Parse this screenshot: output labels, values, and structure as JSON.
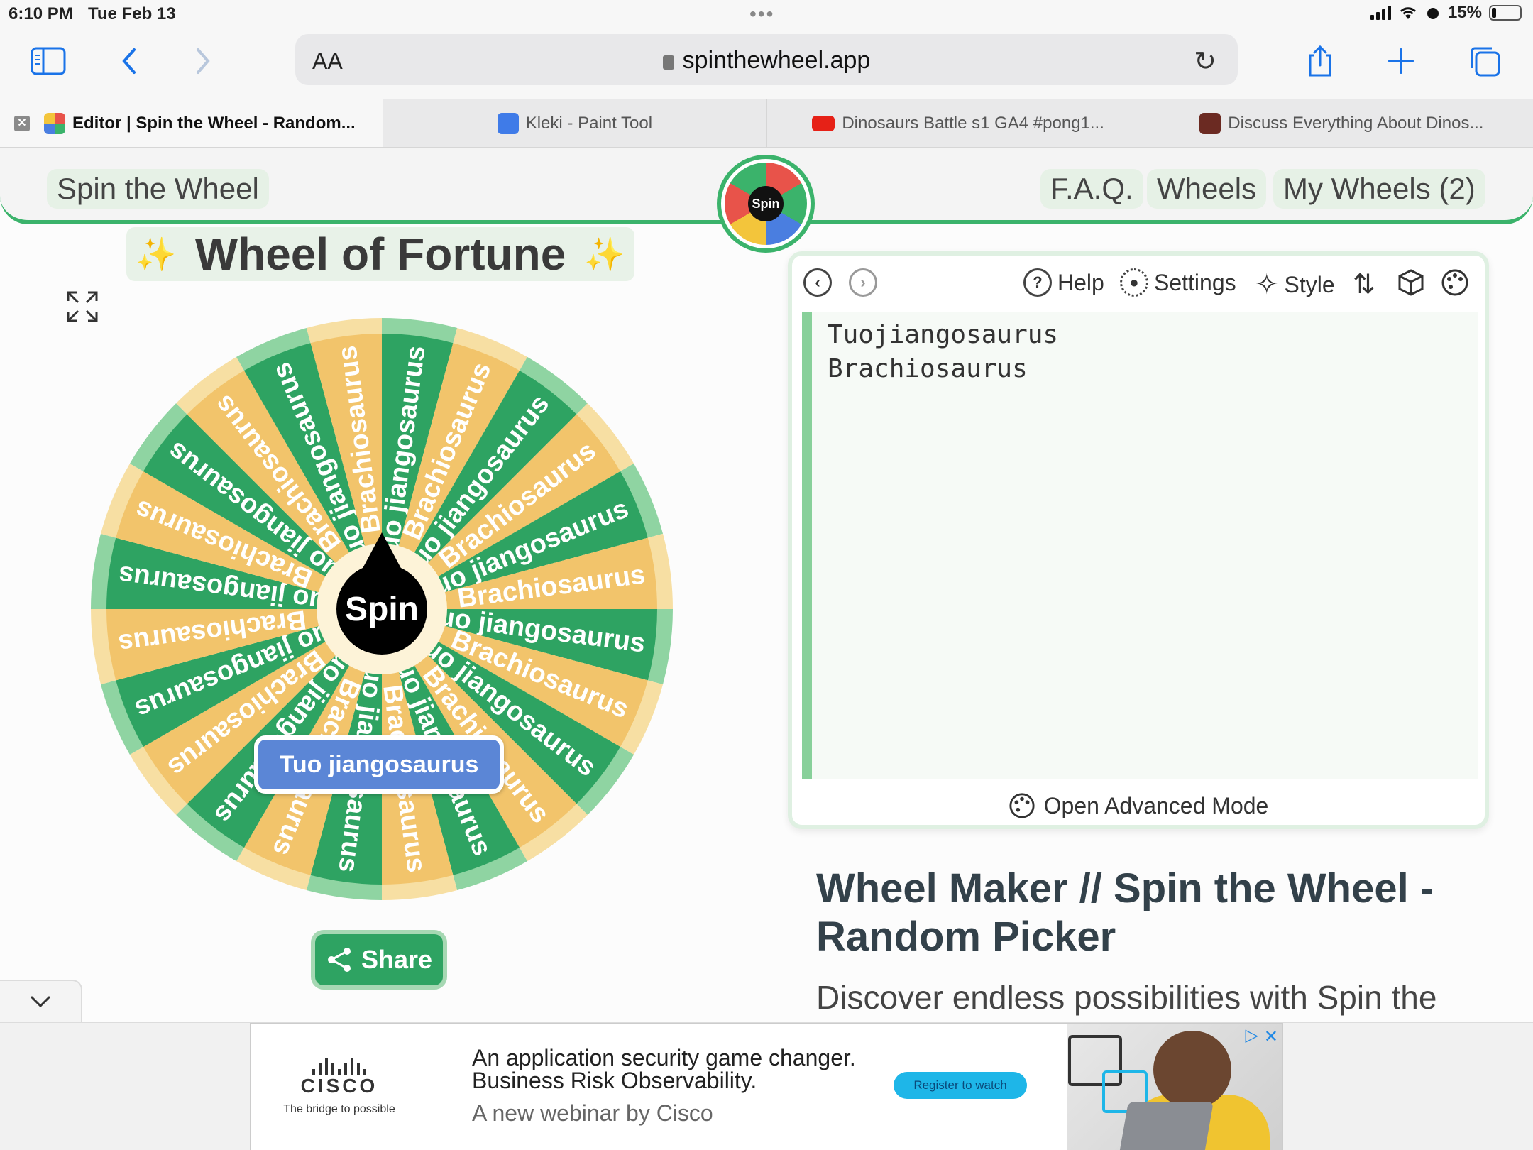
{
  "status": {
    "time": "6:10 PM",
    "date": "Tue Feb 13",
    "dots": "•••",
    "battery": "15%"
  },
  "browser": {
    "aa_label": "AA",
    "url": "spinthewheel.app",
    "icons": [
      "sidebar-icon",
      "back-icon",
      "forward-icon",
      "reload-icon",
      "share-icon",
      "new-tab-icon",
      "tabs-icon"
    ],
    "accent_color": "#1a73e8"
  },
  "tabs": [
    {
      "title": "Editor | Spin the Wheel - Random...",
      "active": true
    },
    {
      "title": "Kleki - Paint Tool",
      "active": false
    },
    {
      "title": "Dinosaurs Battle s1 GA4 #pong1...",
      "active": false
    },
    {
      "title": "Discuss Everything About Dinos...",
      "active": false
    }
  ],
  "site": {
    "brand": "Spin the Wheel",
    "logo_label": "Spin",
    "nav": [
      "F.A.Q.",
      "Wheels",
      "My Wheels (2)"
    ],
    "accent_color": "#3bb36b"
  },
  "wheel": {
    "title": "Wheel of Fortune",
    "sparkle": "✨",
    "spin_label": "Spin",
    "result": "Tuo jiangosaurus",
    "share_label": "Share",
    "segment_labels": [
      "Tuo jiangosaurus",
      "Brachiosaurus"
    ],
    "colors": {
      "green": "#2ea362",
      "yellow": "#f2c46b",
      "rim_green": "#8fd4a2",
      "rim_yellow": "#f7dfa3"
    }
  },
  "editor": {
    "help": "Help",
    "settings": "Settings",
    "style": "Style",
    "entries": [
      "Tuojiangosaurus",
      "Brachiosaurus"
    ],
    "advanced": "Open Advanced Mode"
  },
  "article": {
    "title": "Wheel Maker // Spin the Wheel - Random Picker",
    "body": "Discover endless possibilities with Spin the"
  },
  "ad": {
    "brand": "CISCO",
    "tagline": "The bridge to possible",
    "line1": "An application security game changer.",
    "line2": "Business Risk Observability.",
    "line3": "A new webinar by Cisco",
    "cta": "Register to watch"
  }
}
